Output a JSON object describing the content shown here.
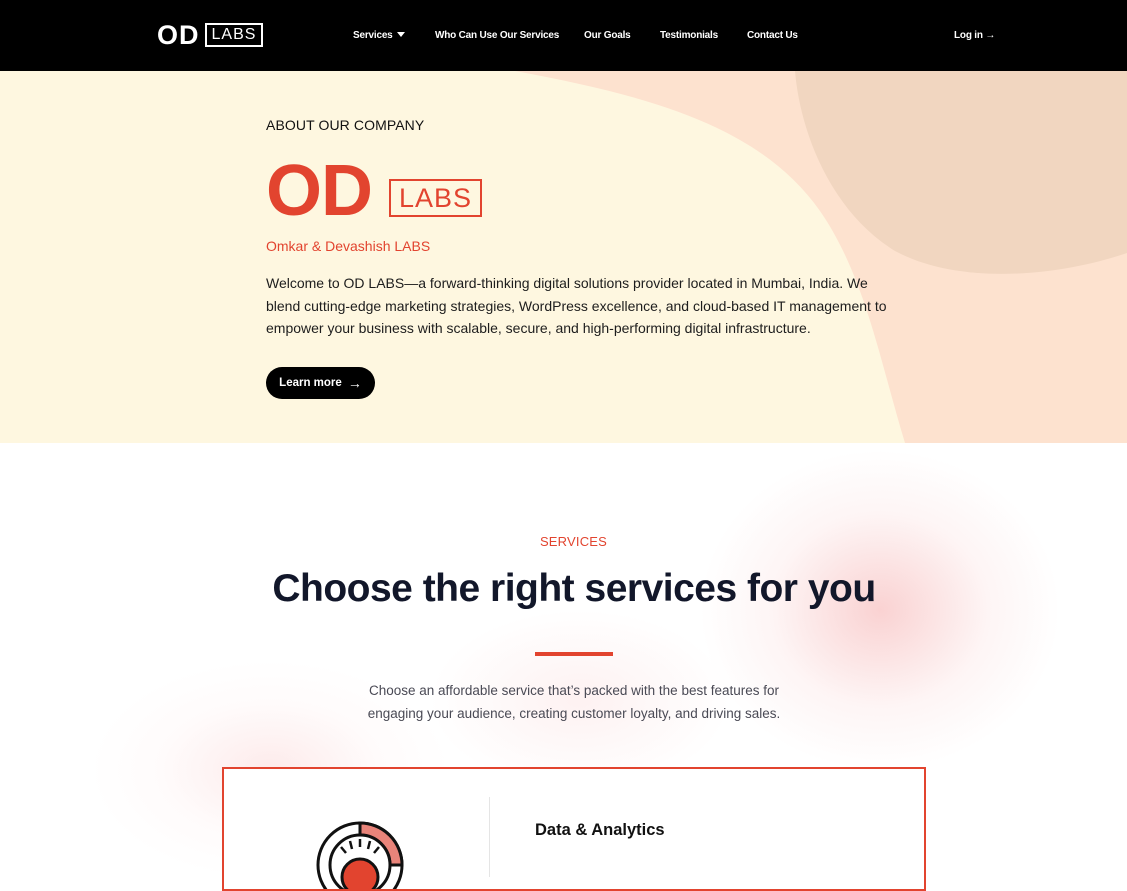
{
  "nav": {
    "logo_main": "OD",
    "logo_boxed": "LABS",
    "links": [
      {
        "label": "Services"
      },
      {
        "label": "Who Can Use Our Services"
      },
      {
        "label": "Our Goals"
      },
      {
        "label": "Testimonials"
      },
      {
        "label": "Contact Us"
      }
    ],
    "login": "Log in →"
  },
  "hero": {
    "eyebrow": "ABOUT OUR COMPANY",
    "brand_main": "OD",
    "brand_boxed": "LABS",
    "tagline": "Omkar & Devashish LABS",
    "intro": "Welcome to OD LABS—a forward-thinking digital solutions provider located in Mumbai, India. We blend cutting-edge marketing strategies, WordPress excellence, and cloud-based IT management to empower your business with scalable, secure, and high-performing digital infrastructure.",
    "cta": "Learn more",
    "cta_icon": "arrow-right-icon"
  },
  "services": {
    "eyebrow": "SERVICES",
    "title": "Choose the right services for you",
    "description_line1": "Choose an affordable service that’s packed with the best features for",
    "description_line2": "engaging your audience, creating customer loyalty, and driving sales.",
    "cards": [
      {
        "title": "Data & Analytics",
        "icon": "data-analytics-icon"
      }
    ]
  },
  "colors": {
    "accent": "#e2442f",
    "hero_bg": "#fef7e0",
    "nav_bg": "#000000",
    "heading": "#12172a"
  }
}
